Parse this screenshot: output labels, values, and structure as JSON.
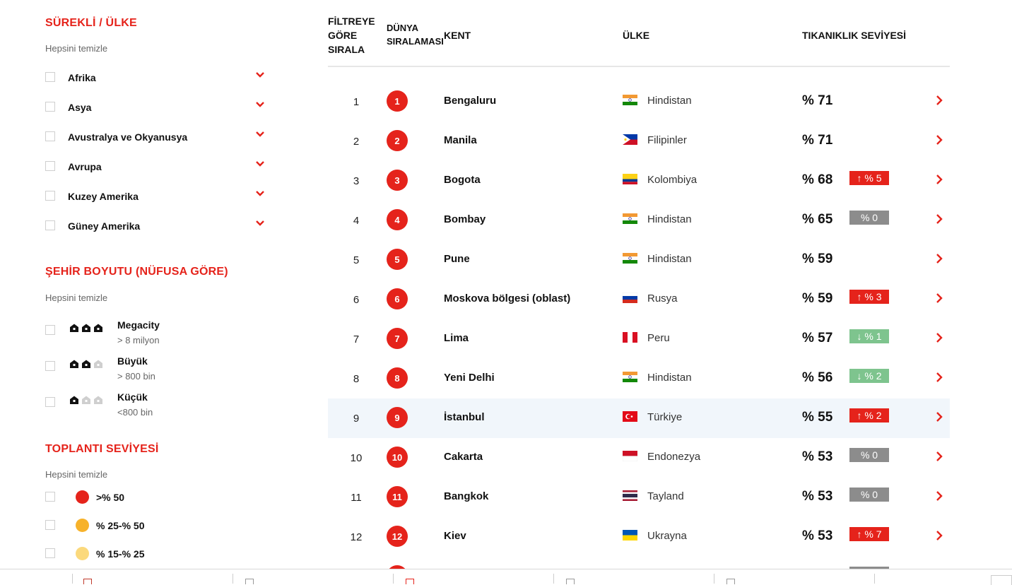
{
  "sidebar": {
    "region": {
      "title": "SÜREKLİ / ÜLKE",
      "clear": "Hepsini temizle",
      "items": [
        {
          "label": "Afrika"
        },
        {
          "label": "Asya"
        },
        {
          "label": "Avustralya ve Okyanusya"
        },
        {
          "label": "Avrupa"
        },
        {
          "label": "Kuzey Amerika"
        },
        {
          "label": "Güney Amerika"
        }
      ]
    },
    "city_size": {
      "title": "ŞEHİR BOYUTU (NÜFUSA GÖRE)",
      "clear": "Hepsini temizle",
      "items": [
        {
          "name": "Megacity",
          "sub": "> 8 milyon",
          "filled_houses": 3
        },
        {
          "name": "Büyük",
          "sub": "> 800 bin",
          "filled_houses": 2
        },
        {
          "name": "Küçük",
          "sub": "<800 bin",
          "filled_houses": 1
        }
      ]
    },
    "congestion": {
      "title": "TOPLANTI SEVİYESİ",
      "clear": "Hepsini temizle",
      "items": [
        {
          "label": ">% 50",
          "color": "#e5231b"
        },
        {
          "label": "% 25-% 50",
          "color": "#f7b22a"
        },
        {
          "label": "% 15-% 25",
          "color": "#fbd97c"
        }
      ]
    }
  },
  "table": {
    "headers": {
      "sort": [
        "FİLTREYE",
        "GÖRE",
        "SIRALA"
      ],
      "world_rank": [
        "DÜNYA",
        "SIRALAMASI"
      ],
      "city": "KENT",
      "country": "ÜLKE",
      "level": "TIKANIKLIK SEVİYESİ"
    },
    "rows": [
      {
        "sort": "1",
        "rank": "1",
        "city": "Bengaluru",
        "flag": "india-flag-icon",
        "country": "Hindistan",
        "level": "% 71",
        "change": "",
        "change_type": "none"
      },
      {
        "sort": "2",
        "rank": "2",
        "city": "Manila",
        "flag": "philippines-flag-icon",
        "country": "Filipinler",
        "level": "% 71",
        "change": "",
        "change_type": "none"
      },
      {
        "sort": "3",
        "rank": "3",
        "city": "Bogota",
        "flag": "colombia-flag-icon",
        "country": "Kolombiya",
        "level": "% 68",
        "change": "↑ % 5",
        "change_type": "up"
      },
      {
        "sort": "4",
        "rank": "4",
        "city": "Bombay",
        "flag": "india-flag-icon",
        "country": "Hindistan",
        "level": "% 65",
        "change": "% 0",
        "change_type": "zero"
      },
      {
        "sort": "5",
        "rank": "5",
        "city": "Pune",
        "flag": "india-flag-icon",
        "country": "Hindistan",
        "level": "% 59",
        "change": "",
        "change_type": "none"
      },
      {
        "sort": "6",
        "rank": "6",
        "city": "Moskova bölgesi (oblast)",
        "flag": "russia-flag-icon",
        "country": "Rusya",
        "level": "% 59",
        "change": "↑ % 3",
        "change_type": "up"
      },
      {
        "sort": "7",
        "rank": "7",
        "city": "Lima",
        "flag": "peru-flag-icon",
        "country": "Peru",
        "level": "% 57",
        "change": "↓ % 1",
        "change_type": "down"
      },
      {
        "sort": "8",
        "rank": "8",
        "city": "Yeni Delhi",
        "flag": "india-flag-icon",
        "country": "Hindistan",
        "level": "% 56",
        "change": "↓ % 2",
        "change_type": "down"
      },
      {
        "sort": "9",
        "rank": "9",
        "city": "İstanbul",
        "flag": "turkey-flag-icon",
        "country": "Türkiye",
        "level": "% 55",
        "change": "↑ % 2",
        "change_type": "up",
        "highlight": true
      },
      {
        "sort": "10",
        "rank": "10",
        "city": "Cakarta",
        "flag": "indonesia-flag-icon",
        "country": "Endonezya",
        "level": "% 53",
        "change": "% 0",
        "change_type": "zero"
      },
      {
        "sort": "11",
        "rank": "11",
        "city": "Bangkok",
        "flag": "thailand-flag-icon",
        "country": "Tayland",
        "level": "% 53",
        "change": "% 0",
        "change_type": "zero"
      },
      {
        "sort": "12",
        "rank": "12",
        "city": "Kiev",
        "flag": "ukraine-flag-icon",
        "country": "Ukrayna",
        "level": "% 53",
        "change": "↑ % 7",
        "change_type": "up"
      }
    ]
  },
  "colors": {
    "accent": "#e5231b",
    "badge_up": "#e5231b",
    "badge_down": "#7ec48e",
    "badge_zero": "#8c8c8c",
    "highlight_row": "#f1f6fb"
  }
}
